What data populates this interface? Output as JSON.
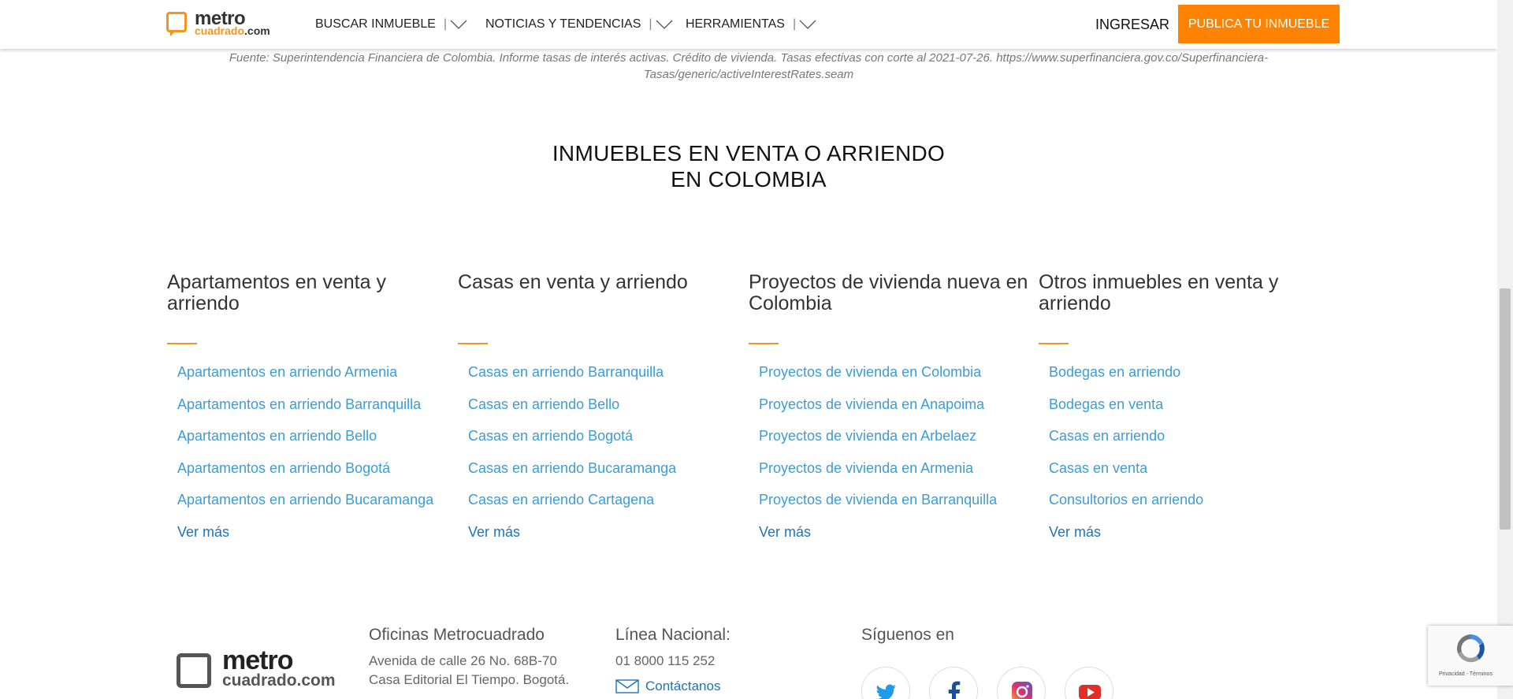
{
  "header": {
    "logo": {
      "main": "metro",
      "sub": "cuadrado",
      "tld": ".com"
    },
    "nav": [
      {
        "label": "BUSCAR INMUEBLE",
        "sep": "|"
      },
      {
        "label": "NOTICIAS Y TENDENCIAS",
        "sep": "|"
      },
      {
        "label": "HERRAMIENTAS",
        "sep": "|"
      }
    ],
    "login_label": "INGRESAR",
    "publish_label": "PUBLICA TU INMUEBLE"
  },
  "source_note": "Fuente: Superintendencia Financiera de Colombia. Informe tasas de interés activas. Crédito de vivienda. Tasas efectivas con corte al 2021-07-26. https://www.superfinanciera.gov.co/Superfinanciera-Tasas/generic/activeInterestRates.seam",
  "section": {
    "title_line1": "INMUEBLES EN VENTA O ARRIENDO",
    "title_line2": "EN COLOMBIA"
  },
  "columns": [
    {
      "title_line1": "Apartamentos en venta y",
      "title_line2": "arriendo",
      "links": [
        "Apartamentos en arriendo Armenia",
        "Apartamentos en arriendo Barranquilla",
        "Apartamentos en arriendo Bello",
        "Apartamentos en arriendo Bogotá",
        "Apartamentos en arriendo Bucaramanga"
      ],
      "more": "Ver más"
    },
    {
      "title_line1": "Casas en venta y arriendo",
      "title_line2": "",
      "links": [
        "Casas en arriendo Barranquilla",
        "Casas en arriendo Bello",
        "Casas en arriendo Bogotá",
        "Casas en arriendo Bucaramanga",
        "Casas en arriendo Cartagena"
      ],
      "more": "Ver más"
    },
    {
      "title_line1": "Proyectos de vivienda nueva en",
      "title_line2": "Colombia",
      "links": [
        "Proyectos de vivienda en Colombia",
        "Proyectos de vivienda en Anapoima",
        "Proyectos de vivienda en Arbelaez",
        "Proyectos de vivienda en Armenia",
        "Proyectos de vivienda en Barranquilla"
      ],
      "more": "Ver más"
    },
    {
      "title_line1": "Otros inmuebles en venta y",
      "title_line2": "arriendo",
      "links": [
        "Bodegas en arriendo",
        "Bodegas en venta",
        "Casas en arriendo",
        "Casas en venta",
        "Consultorios en arriendo"
      ],
      "more": "Ver más"
    }
  ],
  "footer": {
    "logo": {
      "main": "metro",
      "sub": "cuadrado",
      "tld": ".com"
    },
    "offices": {
      "title": "Oficinas Metrocuadrado",
      "line1": "Avenida de calle 26 No. 68B-70",
      "line2": "Casa Editorial El Tiempo. Bogotá."
    },
    "national_line": {
      "title": "Línea Nacional:",
      "phone": "01 8000 115 252",
      "contact": "Contáctanos"
    },
    "social": {
      "title": "Síguenos en",
      "icons": [
        "twitter-icon",
        "facebook-icon",
        "instagram-icon",
        "youtube-icon"
      ]
    }
  },
  "recaptcha": {
    "text": "Privacidad - Términos"
  },
  "colors": {
    "accent": "#ff8200",
    "link": "#3d9cd6",
    "link_strong": "#1e73b9"
  }
}
